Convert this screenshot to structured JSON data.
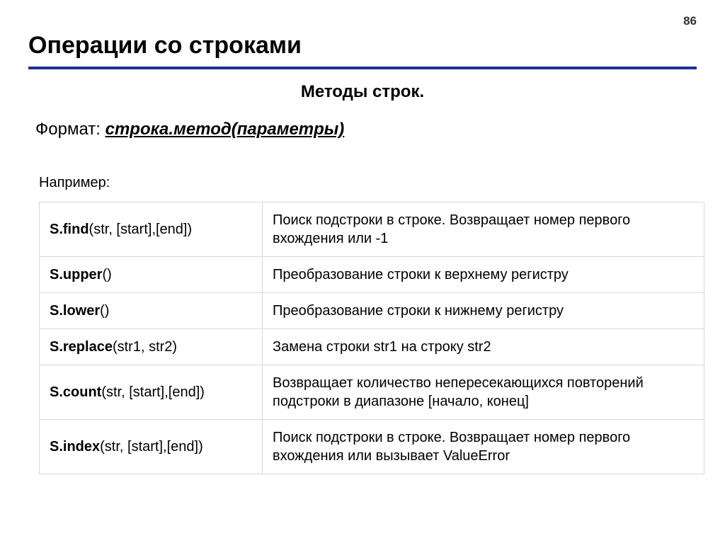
{
  "pageNumber": "86",
  "mainTitle": "Операции со строками",
  "subtitle": "Методы строк.",
  "formatLabel": "Формат: ",
  "formatSyntax": "строка.метод(параметры)",
  "exampleLabel": "Например:",
  "rows": [
    {
      "method": "S.find",
      "params": "(str, [start],[end])",
      "description": "Поиск подстроки в строке. Возвращает номер первого вхождения или -1"
    },
    {
      "method": "S.upper",
      "params": "()",
      "description": "Преобразование строки к верхнему регистру"
    },
    {
      "method": "S.lower",
      "params": "()",
      "description": "Преобразование строки к нижнему регистру"
    },
    {
      "method": "S.replace",
      "params": "(str1, str2)",
      "description": "Замена строки str1 на строку str2"
    },
    {
      "method": "S.count",
      "params": "(str, [start],[end])",
      "description": "Возвращает количество непересекающихся повторений подстроки в диапазоне [начало, конец]"
    },
    {
      "method": "S.index",
      "params": "(str, [start],[end])",
      "description": "Поиск подстроки в строке. Возвращает номер первого вхождения или вызывает ValueError"
    }
  ]
}
